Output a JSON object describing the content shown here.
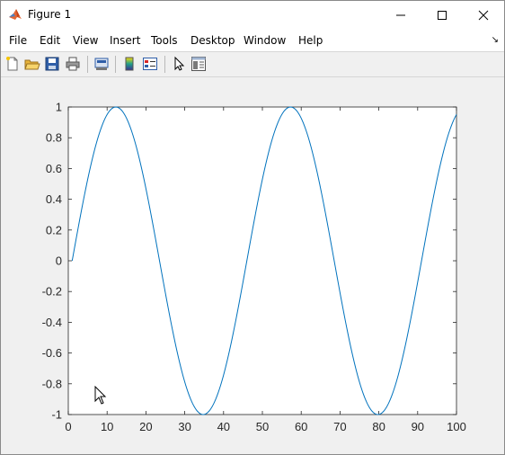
{
  "window": {
    "title": "Figure 1",
    "minimize_label": "—",
    "maximize_label": "☐",
    "close_label": "✕"
  },
  "menu": {
    "items": [
      "File",
      "Edit",
      "View",
      "Insert",
      "Tools",
      "Desktop",
      "Window",
      "Help"
    ],
    "overflow_arrow": "↘"
  },
  "toolbar": {
    "buttons": [
      "new-figure",
      "open-file",
      "save",
      "print",
      "print-preview",
      "colorbar",
      "legend",
      "edit-plot-pointer",
      "property-inspector"
    ]
  },
  "colors": {
    "line": "#0072bd",
    "axes": "#262626",
    "background": "#f0f0f0"
  },
  "chart_data": {
    "type": "line",
    "title": "",
    "xlabel": "",
    "ylabel": "",
    "xlim": [
      0,
      100
    ],
    "ylim": [
      -1,
      1
    ],
    "xticks": [
      0,
      10,
      20,
      30,
      40,
      50,
      60,
      70,
      80,
      90,
      100
    ],
    "yticks": [
      "1",
      "0.8",
      "0.6",
      "0.4",
      "0.2",
      "0",
      "-0.2",
      "-0.4",
      "-0.6",
      "-0.8",
      "-1"
    ],
    "grid": false,
    "series": [
      {
        "function": "sin",
        "x_start": 1,
        "x_end": 100,
        "period": 45,
        "amplitude": 1,
        "x": [
          1,
          12.25,
          23.5,
          34.75,
          46,
          57.25,
          68.5,
          79.75,
          91,
          100
        ],
        "y": [
          0,
          1,
          0,
          -1,
          0,
          1,
          0,
          -1,
          0,
          0.91
        ]
      }
    ]
  }
}
